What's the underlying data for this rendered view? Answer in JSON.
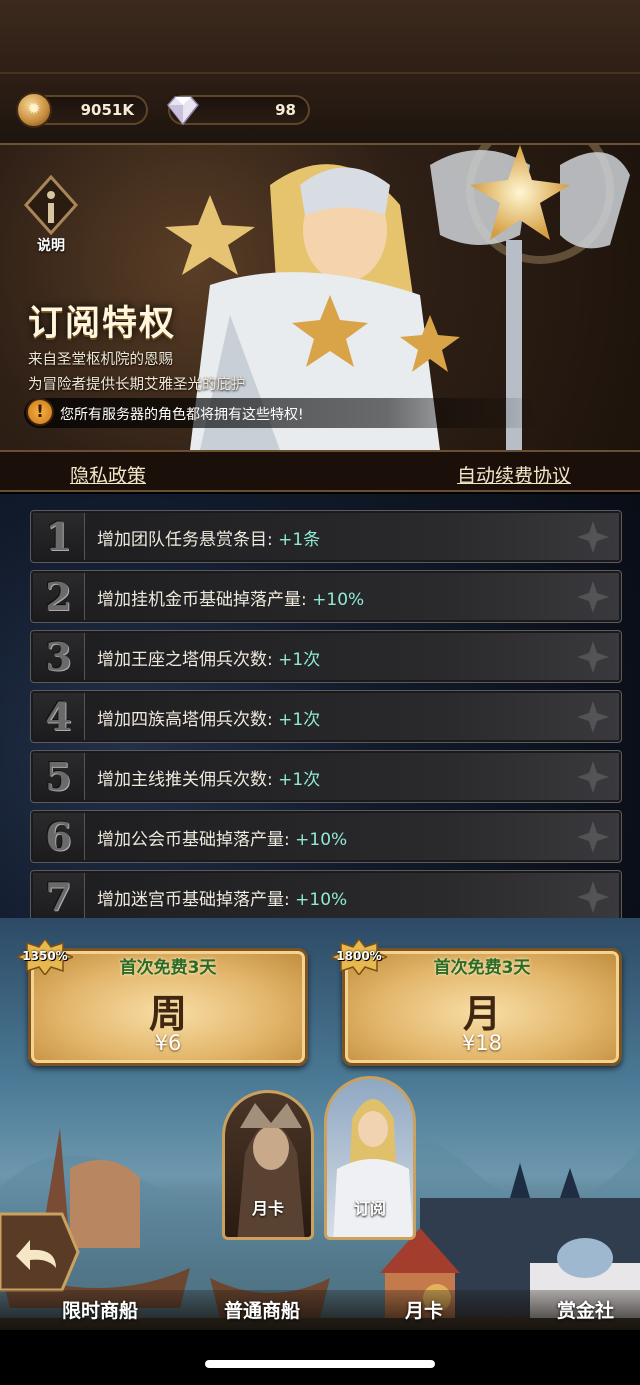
{
  "currency": {
    "gold": "9051K",
    "diamonds": "98"
  },
  "banner": {
    "info_label": "说明",
    "title": "订阅特权",
    "subtitle_1": "来自圣堂枢机院的恩赐",
    "subtitle_2": "为冒险者提供长期艾雅圣光的庇护",
    "notice": "您所有服务器的角色都将拥有这些特权!"
  },
  "links": {
    "privacy": "隐私政策",
    "auto_renew": "自动续费协议"
  },
  "perks": [
    {
      "num": "1",
      "text": "增加团队任务悬赏条目:",
      "value": "+1条"
    },
    {
      "num": "2",
      "text": "增加挂机金币基础掉落产量:",
      "value": "+10%"
    },
    {
      "num": "3",
      "text": "增加王座之塔佣兵次数:",
      "value": "+1次"
    },
    {
      "num": "4",
      "text": "增加四族高塔佣兵次数:",
      "value": "+1次"
    },
    {
      "num": "5",
      "text": "增加主线推关佣兵次数:",
      "value": "+1次"
    },
    {
      "num": "6",
      "text": "增加公会币基础掉落产量:",
      "value": "+10%"
    },
    {
      "num": "7",
      "text": "增加迷宫币基础掉落产量:",
      "value": "+10%"
    }
  ],
  "offers": [
    {
      "badge": "1350%",
      "free": "首次免费3天",
      "kind": "周",
      "price": "¥6"
    },
    {
      "badge": "1800%",
      "free": "首次免费3天",
      "kind": "月",
      "price": "¥18"
    }
  ],
  "portraits": {
    "monthly_card": "月卡",
    "subscribe": "订阅"
  },
  "nav": {
    "limited_ship": "限时商船",
    "normal_ship": "普通商船",
    "monthly_card": "月卡",
    "bounty": "赏金社"
  },
  "colors": {
    "perk_value": "#8fe9d5",
    "free_text": "#2d6b22",
    "gold_accent": "#caa15e"
  }
}
